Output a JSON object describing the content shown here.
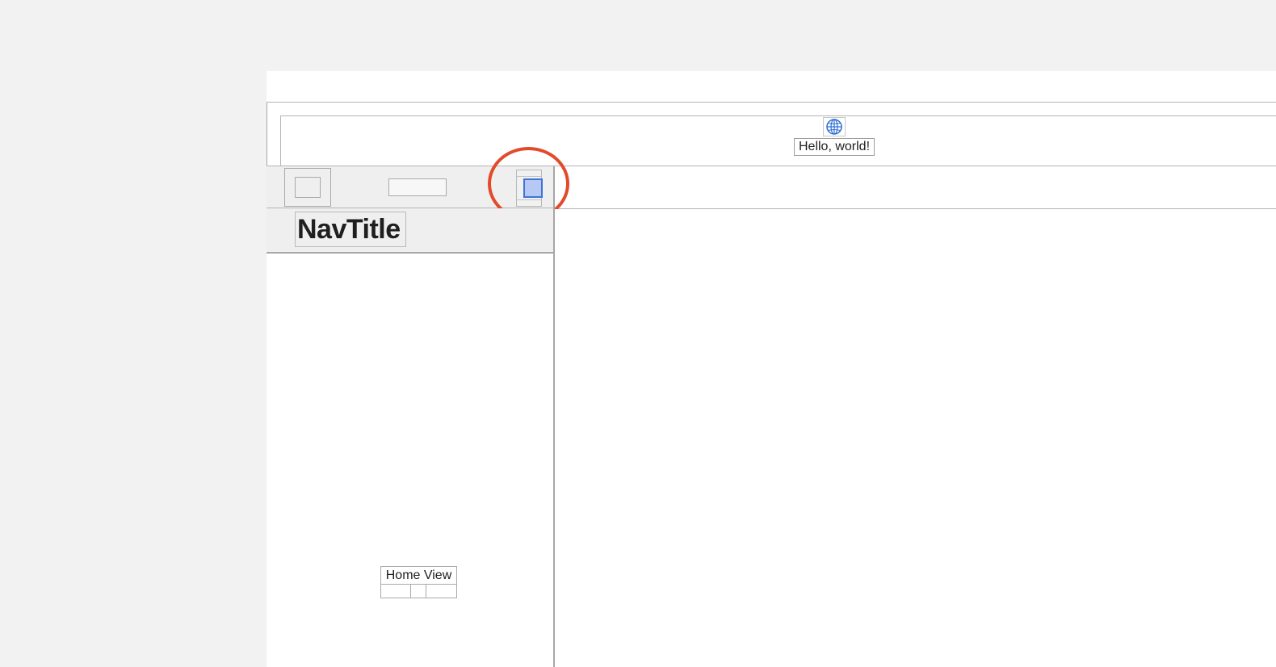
{
  "content": {
    "globe_icon": "globe-icon",
    "hello_text": "Hello, world!",
    "globe_color": "#2f6fd3"
  },
  "toolbar": {
    "selected_fill_color": "#b8c8f5",
    "selected_border_color": "#3e74d9",
    "highlight_color": "#e24a2a"
  },
  "nav": {
    "title": "NavTitle"
  },
  "sidebar": {
    "home_view_label": "Home View"
  }
}
